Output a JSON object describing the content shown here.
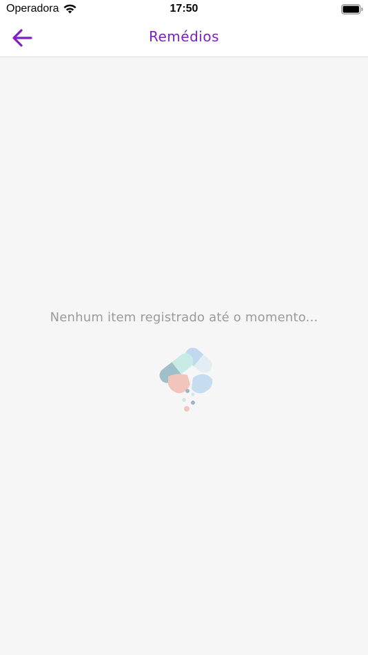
{
  "status_bar": {
    "carrier": "Operadora",
    "time": "17:50",
    "wifi_icon": "wifi-icon",
    "battery_icon": "battery-icon"
  },
  "nav_bar": {
    "title": "Remédios",
    "back_icon": "arrow-left-icon",
    "accent_color": "#7e1fc4"
  },
  "empty_state": {
    "message": "Nenhum item registrado até o momento...",
    "illustration_icon": "pills-icon"
  },
  "colors": {
    "background": "#f6f6f6",
    "header_background": "#ffffff",
    "muted_text": "#9a9a9a"
  }
}
